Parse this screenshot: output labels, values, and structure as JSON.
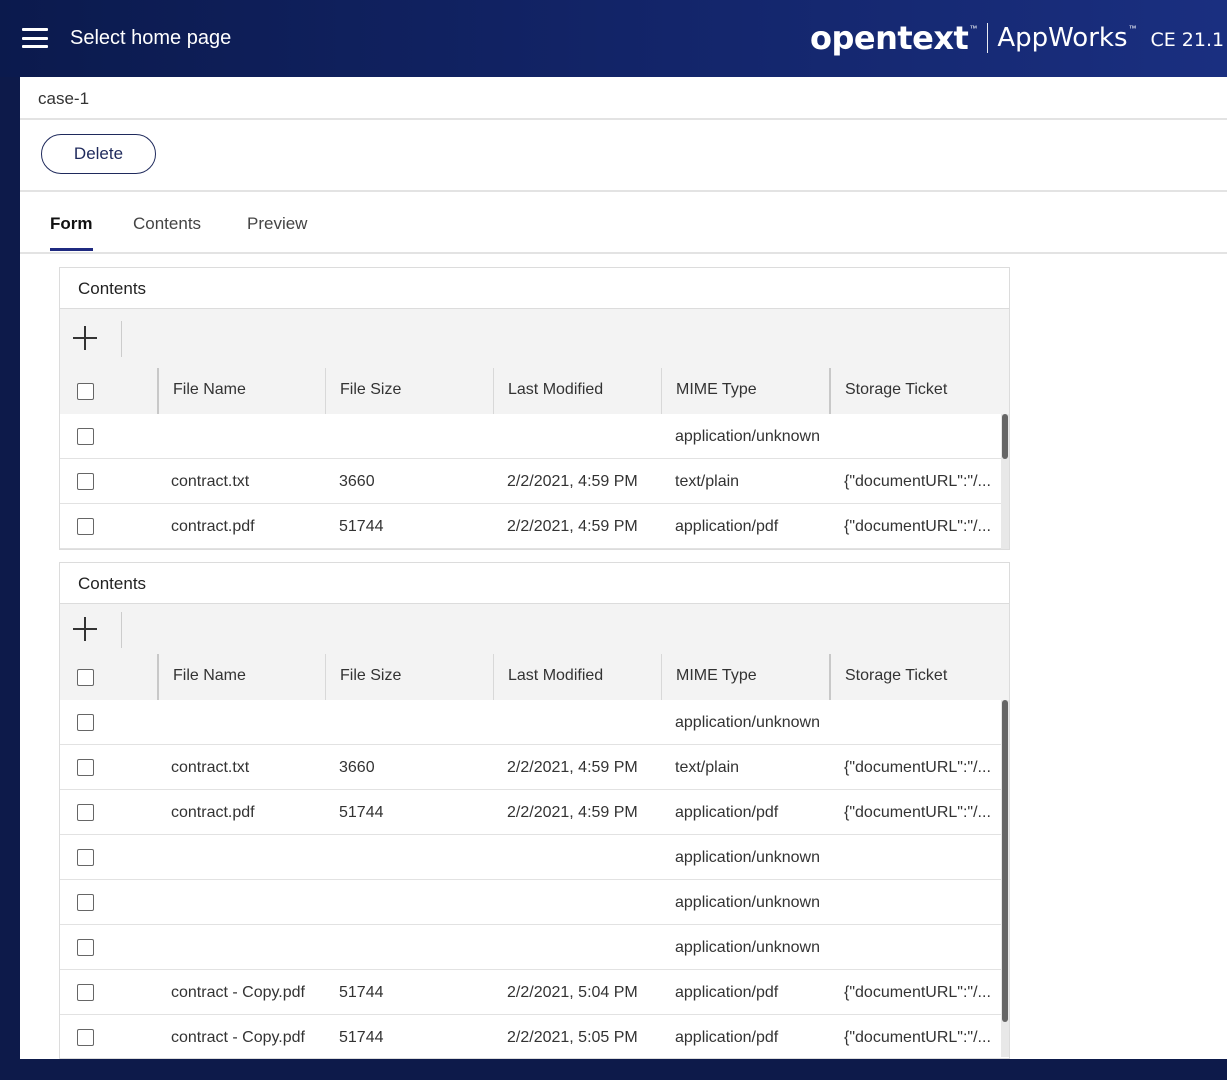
{
  "header": {
    "menu_icon": "hamburger-menu-icon",
    "title": "Select home page",
    "brand_logo": "opentext",
    "brand_product": "AppWorks",
    "brand_version": "CE 21.1"
  },
  "breadcrumb": "case-1",
  "toolbar": {
    "delete_label": "Delete"
  },
  "tabs": [
    {
      "label": "Form",
      "active": true
    },
    {
      "label": "Contents",
      "active": false
    },
    {
      "label": "Preview",
      "active": false
    }
  ],
  "panels": [
    {
      "title": "Contents",
      "add_icon": "plus-icon",
      "columns": [
        "File Name",
        "File Size",
        "Last Modified",
        "MIME Type",
        "Storage Ticket"
      ],
      "rows": [
        {
          "file_name": "",
          "file_size": "",
          "last_modified": "",
          "mime_type": "application/unknown",
          "storage_ticket": ""
        },
        {
          "file_name": "contract.txt",
          "file_size": "3660",
          "last_modified": "2/2/2021, 4:59 PM",
          "mime_type": "text/plain",
          "storage_ticket": "{\"documentURL\":\"/..."
        },
        {
          "file_name": "contract.pdf",
          "file_size": "51744",
          "last_modified": "2/2/2021, 4:59 PM",
          "mime_type": "application/pdf",
          "storage_ticket": "{\"documentURL\":\"/..."
        }
      ]
    },
    {
      "title": "Contents",
      "add_icon": "plus-icon",
      "columns": [
        "File Name",
        "File Size",
        "Last Modified",
        "MIME Type",
        "Storage Ticket"
      ],
      "rows": [
        {
          "file_name": "",
          "file_size": "",
          "last_modified": "",
          "mime_type": "application/unknown",
          "storage_ticket": ""
        },
        {
          "file_name": "contract.txt",
          "file_size": "3660",
          "last_modified": "2/2/2021, 4:59 PM",
          "mime_type": "text/plain",
          "storage_ticket": "{\"documentURL\":\"/..."
        },
        {
          "file_name": "contract.pdf",
          "file_size": "51744",
          "last_modified": "2/2/2021, 4:59 PM",
          "mime_type": "application/pdf",
          "storage_ticket": "{\"documentURL\":\"/..."
        },
        {
          "file_name": "",
          "file_size": "",
          "last_modified": "",
          "mime_type": "application/unknown",
          "storage_ticket": ""
        },
        {
          "file_name": "",
          "file_size": "",
          "last_modified": "",
          "mime_type": "application/unknown",
          "storage_ticket": ""
        },
        {
          "file_name": "",
          "file_size": "",
          "last_modified": "",
          "mime_type": "application/unknown",
          "storage_ticket": ""
        },
        {
          "file_name": "contract - Copy.pdf",
          "file_size": "51744",
          "last_modified": "2/2/2021, 5:04 PM",
          "mime_type": "application/pdf",
          "storage_ticket": "{\"documentURL\":\"/..."
        },
        {
          "file_name": "contract - Copy.pdf",
          "file_size": "51744",
          "last_modified": "2/2/2021, 5:05 PM",
          "mime_type": "application/pdf",
          "storage_ticket": "{\"documentURL\":\"/..."
        }
      ]
    }
  ]
}
